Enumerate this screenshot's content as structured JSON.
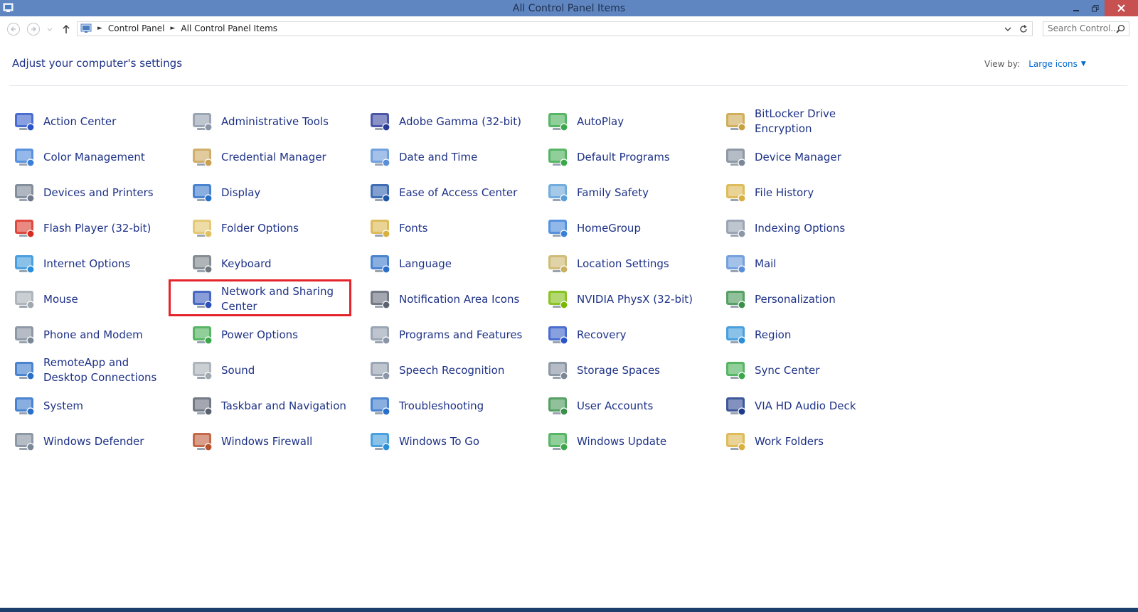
{
  "window": {
    "title": "All Control Panel Items"
  },
  "address": {
    "crumbs": [
      "Control Panel",
      "All Control Panel Items"
    ],
    "search_placeholder": "Search Control..."
  },
  "header": {
    "heading": "Adjust your computer's settings",
    "view_by_label": "View by:",
    "view_by_value": "Large icons"
  },
  "highlight": {
    "item": "Network and Sharing Center",
    "color": "#e3242b"
  },
  "items": [
    {
      "label": "Action Center",
      "icon": "flag-icon",
      "color": "#2a55c8"
    },
    {
      "label": "Administrative Tools",
      "icon": "admin-tools-icon",
      "color": "#8a96a8"
    },
    {
      "label": "Adobe Gamma (32-bit)",
      "icon": "monitor-gamma-icon",
      "color": "#2a3a9a"
    },
    {
      "label": "AutoPlay",
      "icon": "autoplay-icon",
      "color": "#3aa84a"
    },
    {
      "label": "BitLocker Drive Encryption",
      "icon": "bitlocker-key-icon",
      "color": "#c8a040"
    },
    {
      "label": "Color Management",
      "icon": "color-management-icon",
      "color": "#3c7fd8"
    },
    {
      "label": "Credential Manager",
      "icon": "vault-icon",
      "color": "#c9a050"
    },
    {
      "label": "Date and Time",
      "icon": "calendar-clock-icon",
      "color": "#5a8fd8"
    },
    {
      "label": "Default Programs",
      "icon": "default-programs-icon",
      "color": "#3aa84a"
    },
    {
      "label": "Device Manager",
      "icon": "device-manager-icon",
      "color": "#7a8797"
    },
    {
      "label": "Devices and Printers",
      "icon": "printer-icon",
      "color": "#6f7b8c"
    },
    {
      "label": "Display",
      "icon": "display-icon",
      "color": "#2a6fc8"
    },
    {
      "label": "Ease of Access Center",
      "icon": "ease-of-access-icon",
      "color": "#1e55a8"
    },
    {
      "label": "Family Safety",
      "icon": "family-safety-icon",
      "color": "#5a9fd8"
    },
    {
      "label": "File History",
      "icon": "file-history-icon",
      "color": "#d8b040"
    },
    {
      "label": "Flash Player (32-bit)",
      "icon": "flash-icon",
      "color": "#d82a1e"
    },
    {
      "label": "Folder Options",
      "icon": "folder-options-icon",
      "color": "#e0c060"
    },
    {
      "label": "Fonts",
      "icon": "fonts-icon",
      "color": "#d8b040"
    },
    {
      "label": "HomeGroup",
      "icon": "homegroup-icon",
      "color": "#3a7fd8"
    },
    {
      "label": "Indexing Options",
      "icon": "indexing-icon",
      "color": "#8a96a8"
    },
    {
      "label": "Internet Options",
      "icon": "internet-options-icon",
      "color": "#2a8fd8"
    },
    {
      "label": "Keyboard",
      "icon": "keyboard-icon",
      "color": "#707880"
    },
    {
      "label": "Language",
      "icon": "language-icon",
      "color": "#2a6fc8"
    },
    {
      "label": "Location Settings",
      "icon": "location-icon",
      "color": "#c8b060"
    },
    {
      "label": "Mail",
      "icon": "mail-icon",
      "color": "#5a8fd8"
    },
    {
      "label": "Mouse",
      "icon": "mouse-icon",
      "color": "#a0a8b0"
    },
    {
      "label": "Network and Sharing Center",
      "icon": "network-icon",
      "color": "#2a4fb8"
    },
    {
      "label": "Notification Area Icons",
      "icon": "notification-area-icon",
      "color": "#5a6270"
    },
    {
      "label": "NVIDIA PhysX (32-bit)",
      "icon": "nvidia-icon",
      "color": "#76b900"
    },
    {
      "label": "Personalization",
      "icon": "personalization-icon",
      "color": "#3a8f4a"
    },
    {
      "label": "Phone and Modem",
      "icon": "phone-icon",
      "color": "#7a8797"
    },
    {
      "label": "Power Options",
      "icon": "power-icon",
      "color": "#3aa84a"
    },
    {
      "label": "Programs and Features",
      "icon": "programs-icon",
      "color": "#8a96a8"
    },
    {
      "label": "Recovery",
      "icon": "recovery-icon",
      "color": "#2a55c8"
    },
    {
      "label": "Region",
      "icon": "region-icon",
      "color": "#2a8fd8"
    },
    {
      "label": "RemoteApp and Desktop Connections",
      "icon": "remoteapp-icon",
      "color": "#2a6fc8"
    },
    {
      "label": "Sound",
      "icon": "speaker-icon",
      "color": "#a0a8b0"
    },
    {
      "label": "Speech Recognition",
      "icon": "microphone-icon",
      "color": "#8a96a8"
    },
    {
      "label": "Storage Spaces",
      "icon": "storage-icon",
      "color": "#7a8797"
    },
    {
      "label": "Sync Center",
      "icon": "sync-icon",
      "color": "#3aa84a"
    },
    {
      "label": "System",
      "icon": "system-icon",
      "color": "#2a6fc8"
    },
    {
      "label": "Taskbar and Navigation",
      "icon": "taskbar-icon",
      "color": "#5a6270"
    },
    {
      "label": "Troubleshooting",
      "icon": "troubleshooting-icon",
      "color": "#2a6fc8"
    },
    {
      "label": "User Accounts",
      "icon": "user-accounts-icon",
      "color": "#3a8f4a"
    },
    {
      "label": "VIA HD Audio Deck",
      "icon": "via-audio-icon",
      "color": "#1e3a8a"
    },
    {
      "label": "Windows Defender",
      "icon": "defender-icon",
      "color": "#7a8797"
    },
    {
      "label": "Windows Firewall",
      "icon": "firewall-icon",
      "color": "#b8502a"
    },
    {
      "label": "Windows To Go",
      "icon": "windows-to-go-icon",
      "color": "#2a8fd8"
    },
    {
      "label": "Windows Update",
      "icon": "windows-update-icon",
      "color": "#3aa84a"
    },
    {
      "label": "Work Folders",
      "icon": "work-folders-icon",
      "color": "#d8b040"
    }
  ]
}
